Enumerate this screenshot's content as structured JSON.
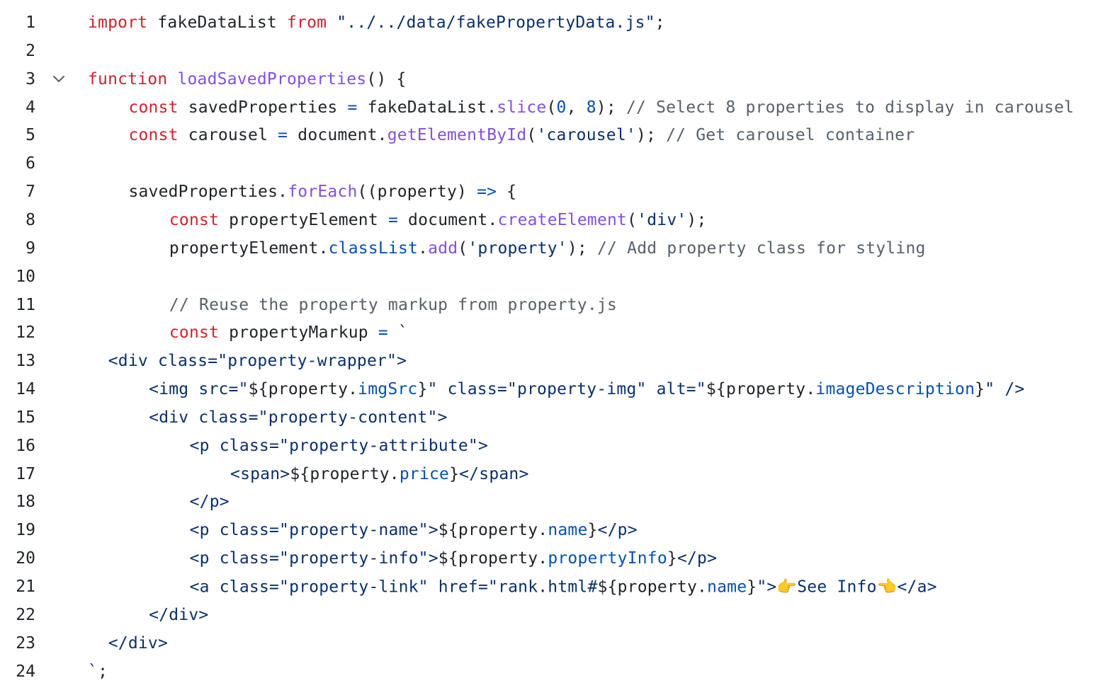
{
  "editor": {
    "fold_icon": "chevron-down-icon",
    "lines": [
      {
        "n": "1",
        "indent": 0,
        "tokens": [
          [
            "kw",
            "import"
          ],
          [
            "pl",
            " fakeDataList "
          ],
          [
            "kw",
            "from"
          ],
          [
            "pl",
            " "
          ],
          [
            "str",
            "\"../../data/fakePropertyData.js\""
          ],
          [
            "pl",
            ";"
          ]
        ]
      },
      {
        "n": "2",
        "indent": 0,
        "tokens": []
      },
      {
        "n": "3",
        "indent": 0,
        "fold": true,
        "tokens": [
          [
            "kw",
            "function"
          ],
          [
            "pl",
            " "
          ],
          [
            "fn",
            "loadSavedProperties"
          ],
          [
            "pl",
            "() {"
          ]
        ]
      },
      {
        "n": "4",
        "indent": 4,
        "tokens": [
          [
            "kw",
            "const"
          ],
          [
            "pl",
            " savedProperties "
          ],
          [
            "op",
            "="
          ],
          [
            "pl",
            " fakeDataList."
          ],
          [
            "fn",
            "slice"
          ],
          [
            "pl",
            "("
          ],
          [
            "num",
            "0"
          ],
          [
            "pl",
            ", "
          ],
          [
            "num",
            "8"
          ],
          [
            "pl",
            "); "
          ],
          [
            "cm",
            "// Select 8 properties to display in carousel"
          ]
        ]
      },
      {
        "n": "5",
        "indent": 4,
        "tokens": [
          [
            "kw",
            "const"
          ],
          [
            "pl",
            " carousel "
          ],
          [
            "op",
            "="
          ],
          [
            "pl",
            " document."
          ],
          [
            "fn",
            "getElementById"
          ],
          [
            "pl",
            "("
          ],
          [
            "str",
            "'carousel'"
          ],
          [
            "pl",
            "); "
          ],
          [
            "cm",
            "// Get carousel container"
          ]
        ]
      },
      {
        "n": "6",
        "indent": 0,
        "tokens": []
      },
      {
        "n": "7",
        "indent": 4,
        "tokens": [
          [
            "pl",
            "savedProperties."
          ],
          [
            "fn",
            "forEach"
          ],
          [
            "pl",
            "((property) "
          ],
          [
            "op",
            "=>"
          ],
          [
            "pl",
            " {"
          ]
        ]
      },
      {
        "n": "8",
        "indent": 8,
        "tokens": [
          [
            "kw",
            "const"
          ],
          [
            "pl",
            " propertyElement "
          ],
          [
            "op",
            "="
          ],
          [
            "pl",
            " document."
          ],
          [
            "fn",
            "createElement"
          ],
          [
            "pl",
            "("
          ],
          [
            "str",
            "'div'"
          ],
          [
            "pl",
            ");"
          ]
        ]
      },
      {
        "n": "9",
        "indent": 8,
        "tokens": [
          [
            "pl",
            "propertyElement."
          ],
          [
            "prop",
            "classList"
          ],
          [
            "pl",
            "."
          ],
          [
            "fn",
            "add"
          ],
          [
            "pl",
            "("
          ],
          [
            "str",
            "'property'"
          ],
          [
            "pl",
            "); "
          ],
          [
            "cm",
            "// Add property class for styling"
          ]
        ]
      },
      {
        "n": "10",
        "indent": 0,
        "tokens": []
      },
      {
        "n": "11",
        "indent": 8,
        "tokens": [
          [
            "cm",
            "// Reuse the property markup from property.js"
          ]
        ]
      },
      {
        "n": "12",
        "indent": 8,
        "tokens": [
          [
            "kw",
            "const"
          ],
          [
            "pl",
            " propertyMarkup "
          ],
          [
            "op",
            "="
          ],
          [
            "pl",
            " "
          ],
          [
            "str",
            "`"
          ]
        ]
      },
      {
        "n": "13",
        "indent": 2,
        "tokens": [
          [
            "str",
            "<div class=\"property-wrapper\">"
          ]
        ]
      },
      {
        "n": "14",
        "indent": 6,
        "tokens": [
          [
            "str",
            "<img src=\""
          ],
          [
            "pl",
            "${property."
          ],
          [
            "prop",
            "imgSrc"
          ],
          [
            "pl",
            "}"
          ],
          [
            "str",
            "\" class=\"property-img\" alt=\""
          ],
          [
            "pl",
            "${property."
          ],
          [
            "prop",
            "imageDescription"
          ],
          [
            "pl",
            "}"
          ],
          [
            "str",
            "\" />"
          ]
        ]
      },
      {
        "n": "15",
        "indent": 6,
        "tokens": [
          [
            "str",
            "<div class=\"property-content\">"
          ]
        ]
      },
      {
        "n": "16",
        "indent": 10,
        "tokens": [
          [
            "str",
            "<p class=\"property-attribute\">"
          ]
        ]
      },
      {
        "n": "17",
        "indent": 14,
        "tokens": [
          [
            "str",
            "<span>"
          ],
          [
            "pl",
            "${property."
          ],
          [
            "prop",
            "price"
          ],
          [
            "pl",
            "}"
          ],
          [
            "str",
            "</span>"
          ]
        ]
      },
      {
        "n": "18",
        "indent": 10,
        "tokens": [
          [
            "str",
            "</p>"
          ]
        ]
      },
      {
        "n": "19",
        "indent": 10,
        "tokens": [
          [
            "str",
            "<p class=\"property-name\">"
          ],
          [
            "pl",
            "${property."
          ],
          [
            "prop",
            "name"
          ],
          [
            "pl",
            "}"
          ],
          [
            "str",
            "</p>"
          ]
        ]
      },
      {
        "n": "20",
        "indent": 10,
        "tokens": [
          [
            "str",
            "<p class=\"property-info\">"
          ],
          [
            "pl",
            "${property."
          ],
          [
            "prop",
            "propertyInfo"
          ],
          [
            "pl",
            "}"
          ],
          [
            "str",
            "</p>"
          ]
        ]
      },
      {
        "n": "21",
        "indent": 10,
        "tokens": [
          [
            "str",
            "<a class=\"property-link\" href=\"rank.html#"
          ],
          [
            "pl",
            "${property."
          ],
          [
            "prop",
            "name"
          ],
          [
            "pl",
            "}"
          ],
          [
            "str",
            "\">👉See Info👈</a>"
          ]
        ]
      },
      {
        "n": "22",
        "indent": 6,
        "tokens": [
          [
            "str",
            "</div>"
          ]
        ]
      },
      {
        "n": "23",
        "indent": 2,
        "tokens": [
          [
            "str",
            "</div>"
          ]
        ]
      },
      {
        "n": "24",
        "indent": 0,
        "tokens": [
          [
            "str",
            "`"
          ],
          [
            "pl",
            ";"
          ]
        ]
      }
    ]
  }
}
